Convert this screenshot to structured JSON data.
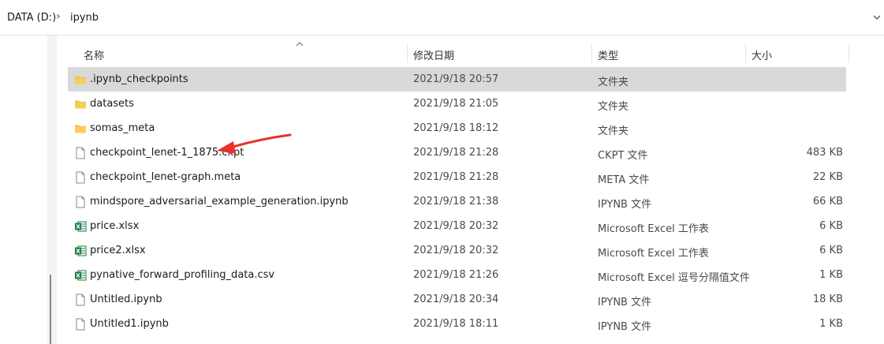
{
  "address": {
    "segments": [
      "DATA (D:)",
      "ipynb"
    ],
    "separator": "›"
  },
  "columns": {
    "name": "名称",
    "date": "修改日期",
    "type": "类型",
    "size": "大小"
  },
  "files": [
    {
      "name": ".ipynb_checkpoints",
      "date": "2021/9/18 20:57",
      "type": "文件夹",
      "size": "",
      "icon": "folder-icon",
      "selected": true
    },
    {
      "name": "datasets",
      "date": "2021/9/18 21:05",
      "type": "文件夹",
      "size": "",
      "icon": "folder-icon"
    },
    {
      "name": "somas_meta",
      "date": "2021/9/18 18:12",
      "type": "文件夹",
      "size": "",
      "icon": "folder-icon"
    },
    {
      "name": "checkpoint_lenet-1_1875.ckpt",
      "date": "2021/9/18 21:28",
      "type": "CKPT 文件",
      "size": "483 KB",
      "icon": "file-icon"
    },
    {
      "name": "checkpoint_lenet-graph.meta",
      "date": "2021/9/18 21:28",
      "type": "META 文件",
      "size": "22 KB",
      "icon": "file-icon"
    },
    {
      "name": "mindspore_adversarial_example_generation.ipynb",
      "date": "2021/9/18 21:38",
      "type": "IPYNB 文件",
      "size": "66 KB",
      "icon": "file-icon"
    },
    {
      "name": "price.xlsx",
      "date": "2021/9/18 20:32",
      "type": "Microsoft Excel 工作表",
      "size": "6 KB",
      "icon": "excel-icon"
    },
    {
      "name": "price2.xlsx",
      "date": "2021/9/18 20:32",
      "type": "Microsoft Excel 工作表",
      "size": "6 KB",
      "icon": "excel-icon"
    },
    {
      "name": "pynative_forward_profiling_data.csv",
      "date": "2021/9/18 21:26",
      "type": "Microsoft Excel 逗号分隔值文件",
      "size": "1 KB",
      "icon": "excel-icon"
    },
    {
      "name": "Untitled.ipynb",
      "date": "2021/9/18 20:34",
      "type": "IPYNB 文件",
      "size": "18 KB",
      "icon": "file-icon"
    },
    {
      "name": "Untitled1.ipynb",
      "date": "2021/9/18 18:11",
      "type": "IPYNB 文件",
      "size": "1 KB",
      "icon": "file-icon"
    }
  ],
  "colors": {
    "selection": "#d9d9d9",
    "folder": "#f5c04a",
    "excel": "#1e7a44",
    "arrow": "#e8312a"
  }
}
